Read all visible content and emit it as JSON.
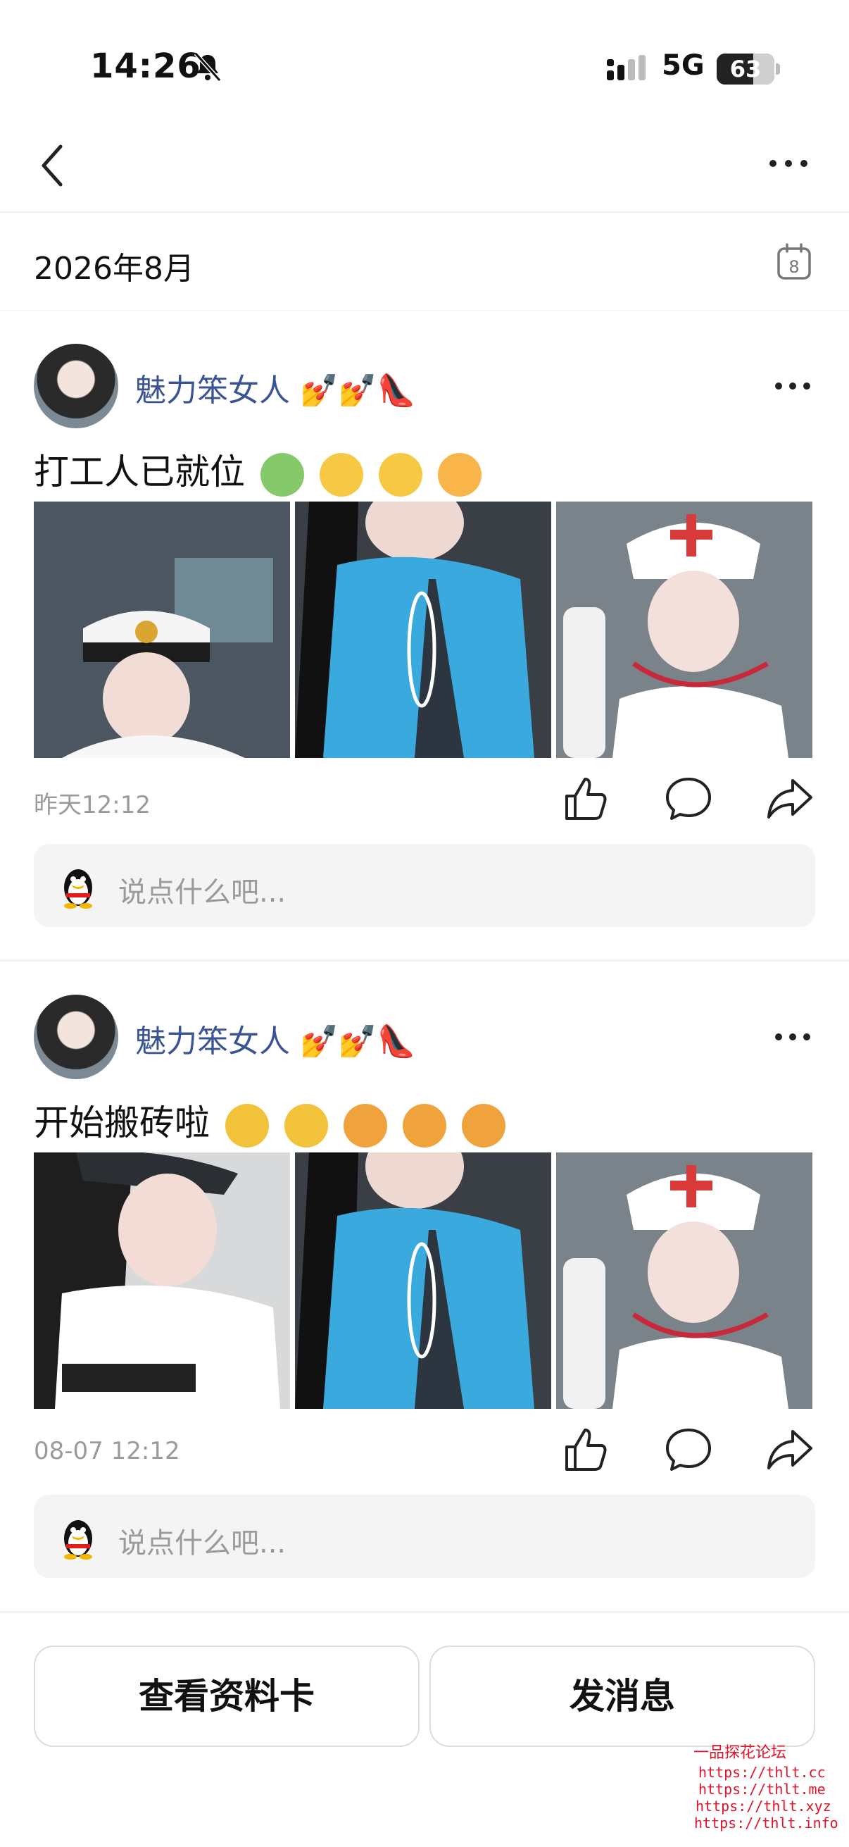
{
  "status_bar": {
    "time": "14:26",
    "network": "5G",
    "battery": "63",
    "battery_level": 0.63
  },
  "header": {
    "month": "2026年8月",
    "calendar_day": "8"
  },
  "posts": [
    {
      "username": "魅力笨女人",
      "username_emoji": [
        "💅",
        "💅",
        "👠"
      ],
      "text": "打工人已就位",
      "timestamp": "昨天12:12",
      "comment_placeholder": "说点什么吧..."
    },
    {
      "username": "魅力笨女人",
      "username_emoji": [
        "💅",
        "💅",
        "👠"
      ],
      "text": "开始搬砖啦",
      "timestamp": "08-07 12:12",
      "comment_placeholder": "说点什么吧..."
    }
  ],
  "bottom": {
    "profile_button": "查看资料卡",
    "message_button": "发消息"
  },
  "watermark": {
    "title": "一品探花论坛",
    "links": [
      "https://thlt.cc",
      "https://thlt.me",
      "https://thlt.xyz",
      "https://thlt.info"
    ]
  },
  "icons": {
    "back": "chevron-left-icon",
    "more": "more-icon",
    "calendar": "calendar-icon",
    "like": "thumbs-up-icon",
    "comment": "comment-icon",
    "share": "share-icon",
    "qq": "qq-penguin-icon"
  }
}
